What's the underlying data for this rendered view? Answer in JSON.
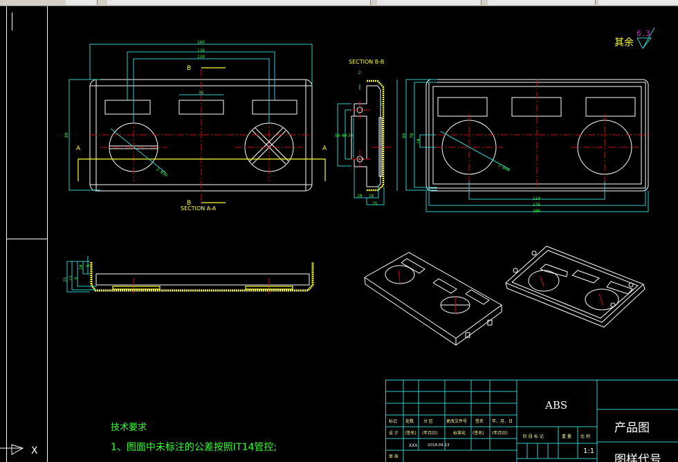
{
  "drawing": {
    "roughness": {
      "prefix": "其余",
      "value": "6.3"
    },
    "front_view": {
      "dims": {
        "width": "160",
        "inner1": "120",
        "inner2": "110",
        "slot": "36",
        "height": "80",
        "hole": "2-Ø30"
      },
      "section_mark": "B",
      "section_label": "SECTION A-A",
      "cut_mark": "A"
    },
    "section_bb": {
      "title": "SECTION B-B",
      "dims": [
        "10",
        "10",
        "15",
        "5",
        "2",
        "50",
        "40",
        "30"
      ]
    },
    "back_view": {
      "dims": {
        "d110": "110",
        "d176": "176",
        "d180": "180",
        "h80": "80",
        "h78": "78",
        "h10": "10",
        "hole": "2-Ø44"
      }
    },
    "side_view": {
      "dims": [
        "25",
        "13",
        "8",
        "10",
        "5"
      ]
    },
    "notes": {
      "title": "技术要求",
      "item1": "1、图面中未标注的公差按照IT14管控;"
    },
    "ucs": {
      "x_label": "X"
    }
  },
  "title_block": {
    "header": [
      "标记",
      "处数",
      "分 区",
      "更改文件号",
      "签名",
      "年、月、日"
    ],
    "design_row": [
      "设 计",
      "(签名)",
      "(年月日)",
      "标准化",
      "(签名)",
      "(年月日)"
    ],
    "designer": "XXX",
    "date": "2018.04.13",
    "review": "审 核",
    "material": "ABS",
    "stage_header": [
      "阶 段 标 记",
      "重 量",
      "比 例"
    ],
    "scale": "1:1",
    "drawing_name": "产品图",
    "drawing_code": "图样代号"
  },
  "colors": {
    "background": "#000000",
    "outline": "#ffffff",
    "dimension": "#33cccc",
    "dim_text": "#33ff33",
    "section": "#ffff33",
    "centerline": "#cc1111",
    "roughness_value": "#cc33cc"
  }
}
